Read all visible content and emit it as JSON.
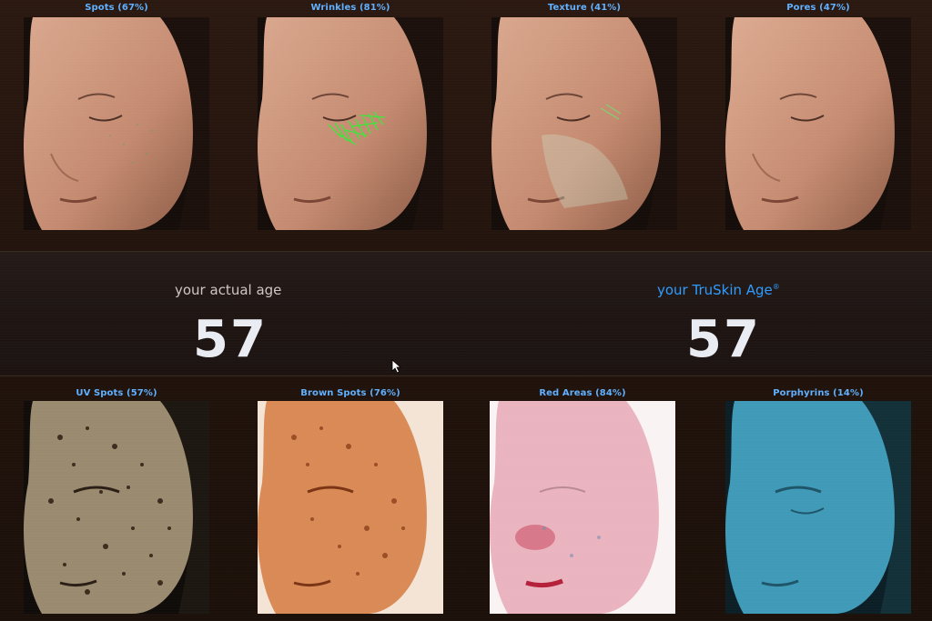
{
  "top_row": [
    {
      "label": "Spots (67%)",
      "overlay": "spots"
    },
    {
      "label": "Wrinkles (81%)",
      "overlay": "wrinkles"
    },
    {
      "label": "Texture (41%)",
      "overlay": "texture"
    },
    {
      "label": "Pores (47%)",
      "overlay": "pores"
    }
  ],
  "ages": {
    "actual_label": "your actual age",
    "actual_value": "57",
    "truskin_label": "your TruSkin Age",
    "truskin_mark": "®",
    "truskin_value": "57"
  },
  "bottom_row": [
    {
      "label": "UV Spots (57%)",
      "filter": "uv"
    },
    {
      "label": "Brown Spots (76%)",
      "filter": "brown"
    },
    {
      "label": "Red Areas (84%)",
      "filter": "red"
    },
    {
      "label": "Porphyrins (14%)",
      "filter": "porphyrins"
    }
  ],
  "colors": {
    "label_blue": "#5fb0ff",
    "truskin_blue": "#2e9bff",
    "wrinkle_overlay": "#39e83a",
    "background": "#22130c"
  },
  "icons": {
    "cursor": "mouse-pointer-icon"
  }
}
